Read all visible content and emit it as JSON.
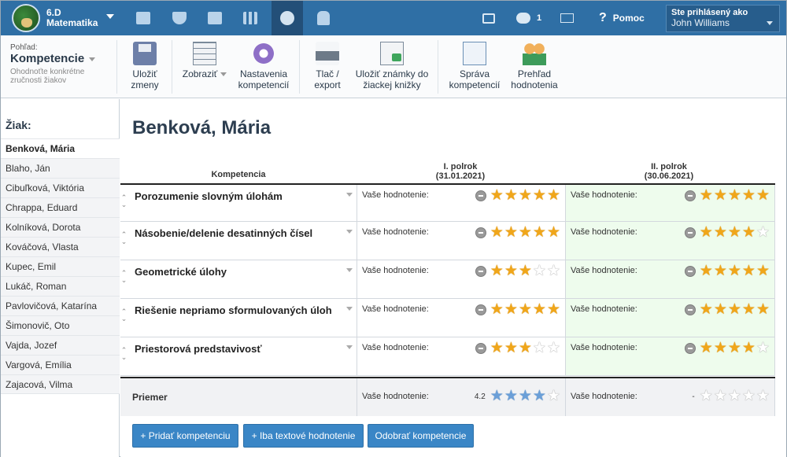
{
  "header": {
    "class_name": "6.D",
    "subject": "Matematika",
    "message_count": "1",
    "help_label": "Pomoc",
    "logged_in_label": "Ste prihlásený ako",
    "user_name": "John Williams"
  },
  "toolbar": {
    "view_label": "Pohľad:",
    "view_name": "Kompetencie",
    "view_description": "Ohodnoťte konkrétne zručnosti žiakov",
    "save": [
      "Uložiť",
      "zmeny"
    ],
    "show": "Zobraziť",
    "settings": [
      "Nastavenia",
      "kompetencií"
    ],
    "print": [
      "Tlač /",
      "export"
    ],
    "save_grades": [
      "Uložiť známky do",
      "žiackej knižky"
    ],
    "manage": [
      "Správa",
      "kompetencií"
    ],
    "overview": [
      "Prehľad",
      "hodnotenia"
    ]
  },
  "sidebar": {
    "title": "Žiak:",
    "students": [
      "Benková, Mária",
      "Blaho, Ján",
      "Cibuľková, Viktória",
      "Chrappa, Eduard",
      "Kolníková, Dorota",
      "Kováčová, Vlasta",
      "Kupec, Emil",
      "Lukáč, Roman",
      "Pavlovičová, Katarína",
      "Šimonovič, Oto",
      "Vajda, Jozef",
      "Vargová, Emília",
      "Zajacová, Vilma"
    ]
  },
  "main": {
    "student_name": "Benková, Mária",
    "col_competence": "Kompetencia",
    "term1_title": "I. polrok",
    "term1_date": "(31.01.2021)",
    "term2_title": "II. polrok",
    "term2_date": "(30.06.2021)",
    "rating_label": "Vaše hodnotenie:",
    "competencies": [
      {
        "name": "Porozumenie slovným úlohám",
        "term1": 5,
        "term2": 5
      },
      {
        "name": "Násobenie/delenie desatinných čísel",
        "term1": 5,
        "term2": 4
      },
      {
        "name": "Geometrické úlohy",
        "term1": 3,
        "term2": 5
      },
      {
        "name": "Riešenie nepriamo sformulovaných úloh",
        "term1": 5,
        "term2": 5
      },
      {
        "name": "Priestorová predstavivosť",
        "term1": 3,
        "term2": 4
      }
    ],
    "average_label": "Priemer",
    "average_term1": "4.2",
    "average_term1_stars": 4,
    "average_term2": "-",
    "average_term2_stars": 0
  },
  "buttons": {
    "add": "+ Pridať kompetenciu",
    "text_only": "+ Iba textové hodnotenie",
    "remove": "Odobrať kompetencie"
  }
}
